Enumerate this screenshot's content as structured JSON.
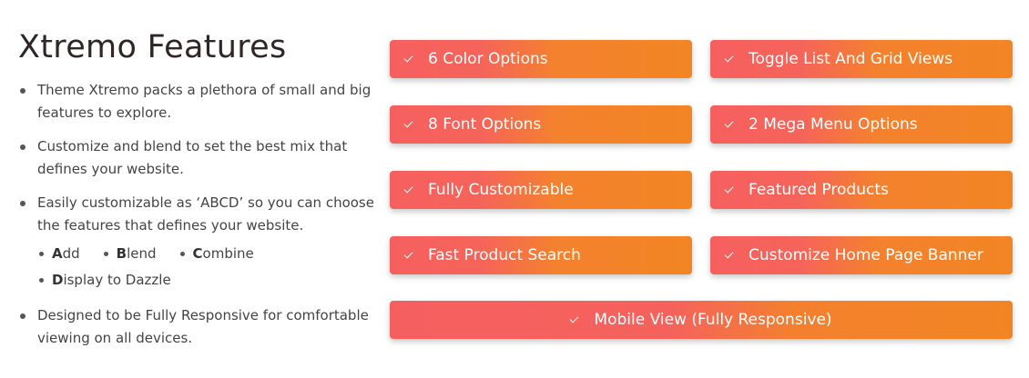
{
  "section": {
    "title": "Xtremo Features"
  },
  "bullets": [
    {
      "text": "Theme Xtremo packs a plethora of small and big features to explore."
    },
    {
      "text": "Customize and blend to set the best mix that defines your website."
    },
    {
      "text": "Easily customizable as ‘ABCD’ so you can choose the features that defines your website."
    },
    {
      "text": "Designed to be Fully Responsive for comfortable viewing on all devices."
    }
  ],
  "abcd": [
    {
      "first": "A",
      "rest": "dd"
    },
    {
      "first": "B",
      "rest": "lend"
    },
    {
      "first": "C",
      "rest": "ombine"
    },
    {
      "first": "D",
      "rest": "isplay to Dazzle"
    }
  ],
  "features": [
    {
      "label": "6 Color Options",
      "icon": "check-icon"
    },
    {
      "label": "Toggle List And Grid Views",
      "icon": "check-icon"
    },
    {
      "label": "8 Font Options",
      "icon": "check-icon"
    },
    {
      "label": "2 Mega Menu Options",
      "icon": "check-icon"
    },
    {
      "label": "Fully Customizable",
      "icon": "check-icon"
    },
    {
      "label": "Featured Products",
      "icon": "check-icon"
    },
    {
      "label": "Fast Product Search",
      "icon": "check-icon"
    },
    {
      "label": "Customize Home Page Banner",
      "icon": "check-icon"
    },
    {
      "label": "Mobile View (Fully Responsive)",
      "icon": "check-icon"
    }
  ],
  "colors": {
    "gradient_start": "#f65f5f",
    "gradient_end": "#f28523",
    "title": "#2f2626",
    "text": "#444444"
  }
}
